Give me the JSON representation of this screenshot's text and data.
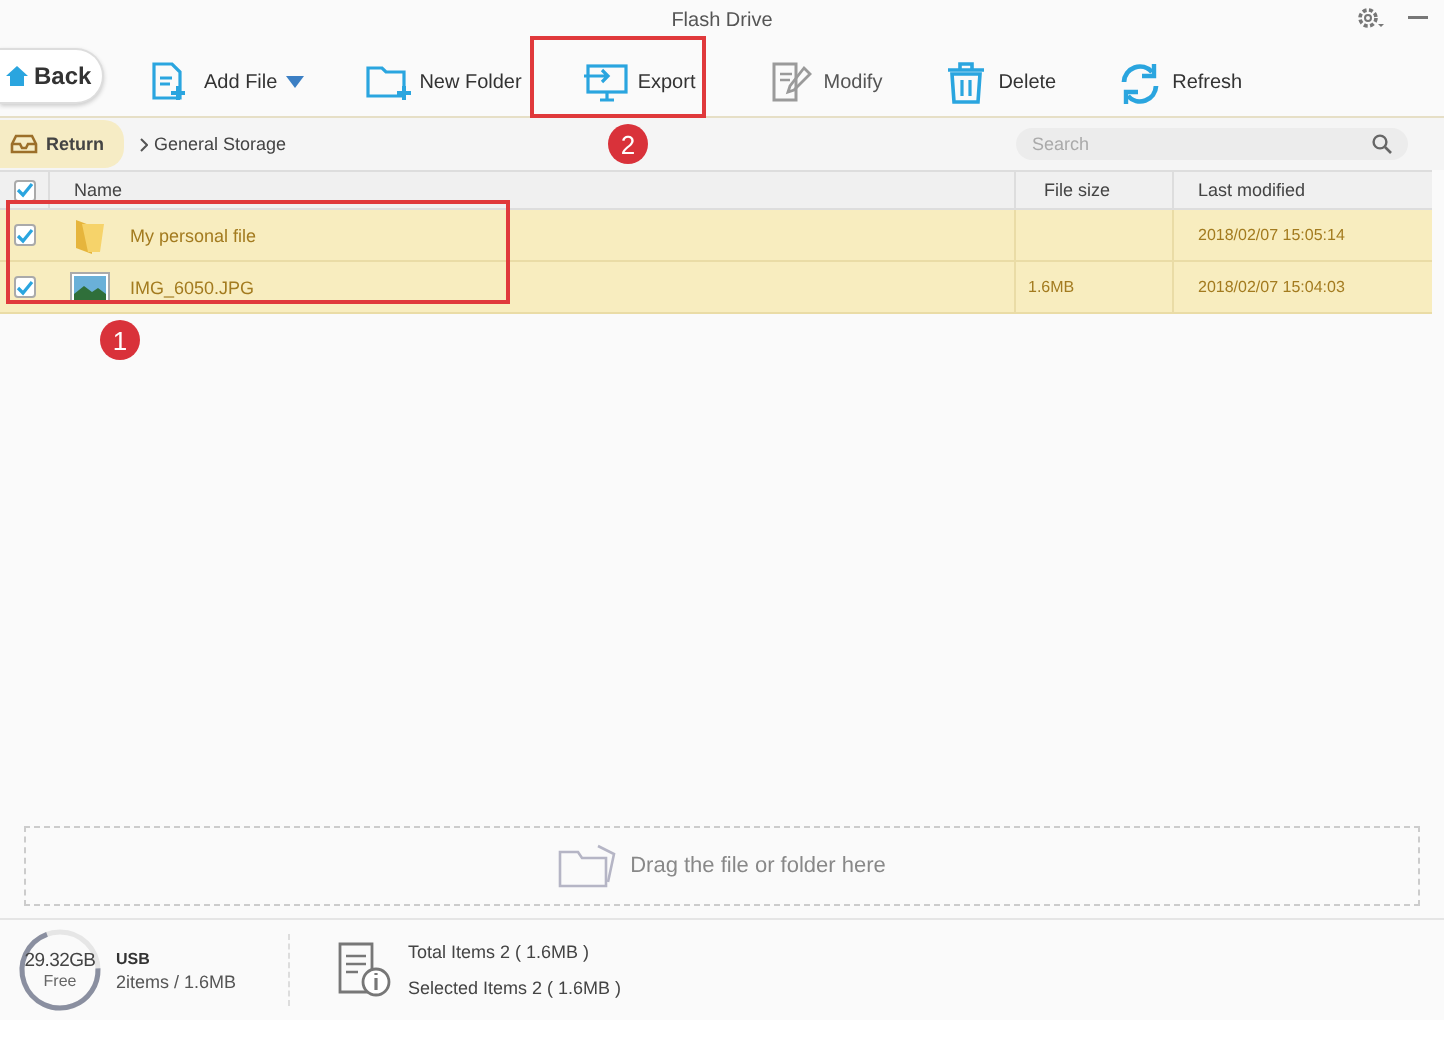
{
  "window": {
    "title": "Flash Drive"
  },
  "back_button": {
    "label": "Back"
  },
  "toolbar": [
    {
      "label": "Add File",
      "dropdown": true,
      "disabled": false
    },
    {
      "label": "New Folder",
      "dropdown": false,
      "disabled": false
    },
    {
      "label": "Export",
      "dropdown": false,
      "disabled": false
    },
    {
      "label": "Modify",
      "dropdown": false,
      "disabled": true
    },
    {
      "label": "Delete",
      "dropdown": false,
      "disabled": false
    },
    {
      "label": "Refresh",
      "dropdown": false,
      "disabled": false
    }
  ],
  "breadcrumb": {
    "return_label": "Return",
    "path": "General Storage"
  },
  "search": {
    "placeholder": "Search"
  },
  "table": {
    "all_checked": true,
    "columns": [
      "Name",
      "File size",
      "Last modified"
    ],
    "rows": [
      {
        "kind": "folder",
        "name": "My personal file",
        "size": "",
        "modified": "2018/02/07 15:05:14",
        "checked": true,
        "selected": true
      },
      {
        "kind": "image",
        "name": "IMG_6050.JPG",
        "size": "1.6MB",
        "modified": "2018/02/07 15:04:03",
        "checked": true,
        "selected": true
      }
    ]
  },
  "drop_zone": {
    "label": "Drag the file or folder here"
  },
  "status": {
    "free": "29.32GB",
    "free_label": "Free",
    "level": 0.7,
    "device": "USB",
    "device_summary": "2items / 1.6MB",
    "total": "Total Items 2 ( 1.6MB )",
    "selected": "Selected Items 2 ( 1.6MB )"
  },
  "annotations": [
    {
      "label": "1"
    },
    {
      "label": "2"
    }
  ]
}
